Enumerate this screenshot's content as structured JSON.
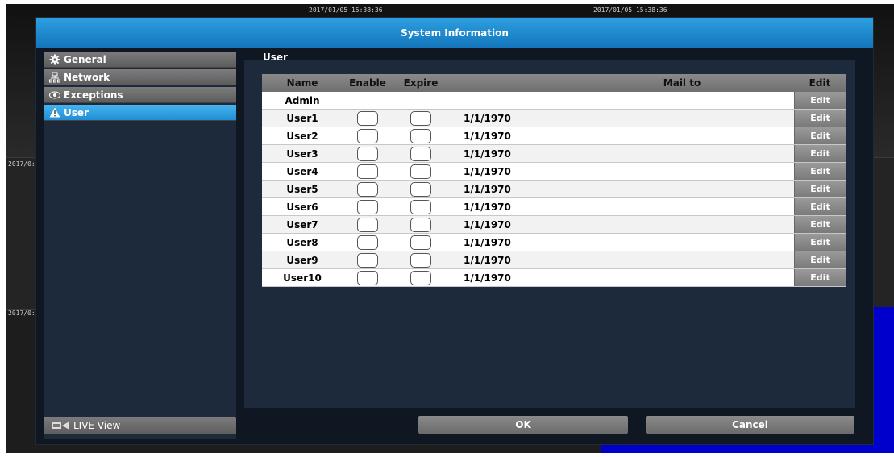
{
  "overlay": {
    "timestamp_1": "2017/01/05 15:38:36",
    "timestamp_2": "2017/01/05 15:38:36",
    "side_label_1": "2017/0:",
    "side_label_2": "2017/0:"
  },
  "dialog": {
    "title": "System Information",
    "title_bar_color": "#1e8fd4"
  },
  "sidebar": {
    "items": [
      {
        "label": "General",
        "icon": "gear-icon"
      },
      {
        "label": "Network",
        "icon": "network-icon"
      },
      {
        "label": "Exceptions",
        "icon": "eye-icon"
      },
      {
        "label": "User",
        "icon": "warning-icon",
        "active": true
      }
    ],
    "live_view": {
      "label": "LIVE View",
      "icon": "camera-icon"
    }
  },
  "main": {
    "tab_label": "User",
    "table": {
      "headers": {
        "name": "Name",
        "enable": "Enable",
        "expire": "Expire",
        "mail": "Mail to",
        "edit": "Edit"
      },
      "admin": {
        "name": "Admin",
        "edit": "Edit"
      },
      "rows": [
        {
          "name": "User1",
          "date": "1/1/1970",
          "edit": "Edit"
        },
        {
          "name": "User2",
          "date": "1/1/1970",
          "edit": "Edit"
        },
        {
          "name": "User3",
          "date": "1/1/1970",
          "edit": "Edit"
        },
        {
          "name": "User4",
          "date": "1/1/1970",
          "edit": "Edit"
        },
        {
          "name": "User5",
          "date": "1/1/1970",
          "edit": "Edit"
        },
        {
          "name": "User6",
          "date": "1/1/1970",
          "edit": "Edit"
        },
        {
          "name": "User7",
          "date": "1/1/1970",
          "edit": "Edit"
        },
        {
          "name": "User8",
          "date": "1/1/1970",
          "edit": "Edit"
        },
        {
          "name": "User9",
          "date": "1/1/1970",
          "edit": "Edit"
        },
        {
          "name": "User10",
          "date": "1/1/1970",
          "edit": "Edit"
        }
      ]
    }
  },
  "buttons": {
    "ok": "OK",
    "cancel": "Cancel"
  }
}
